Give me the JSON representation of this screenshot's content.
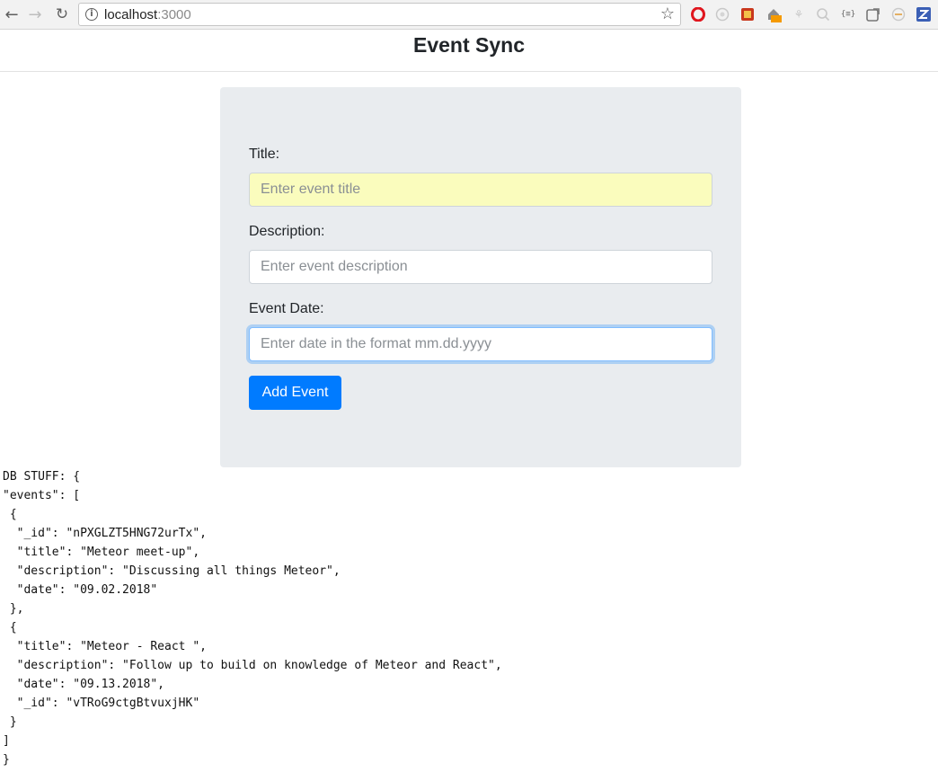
{
  "browser": {
    "url_host": "localhost",
    "url_port": ":3000"
  },
  "app": {
    "title": "Event Sync"
  },
  "form": {
    "title_label": "Title:",
    "title_placeholder": "Enter event title",
    "description_label": "Description:",
    "description_placeholder": "Enter event description",
    "date_label": "Event Date:",
    "date_placeholder": "Enter date in the format mm.dd.yyyy",
    "submit_label": "Add Event"
  },
  "db": {
    "lines": [
      "DB STUFF: {",
      "\"events\": [",
      " {",
      "  \"_id\": \"nPXGLZT5HNG72urTx\",",
      "  \"title\": \"Meteor meet-up\",",
      "  \"description\": \"Discussing all things Meteor\",",
      "  \"date\": \"09.02.2018\"",
      " },",
      " {",
      "  \"title\": \"Meteor - React \",",
      "  \"description\": \"Follow up to build on knowledge of Meteor and React\",",
      "  \"date\": \"09.13.2018\",",
      "  \"_id\": \"vTRoG9ctgBtvuxjHK\"",
      " }",
      "]",
      "}"
    ]
  },
  "colors": {
    "primary": "#007bff",
    "card_bg": "#e9ecef",
    "autofill_bg": "#fafcbd"
  }
}
